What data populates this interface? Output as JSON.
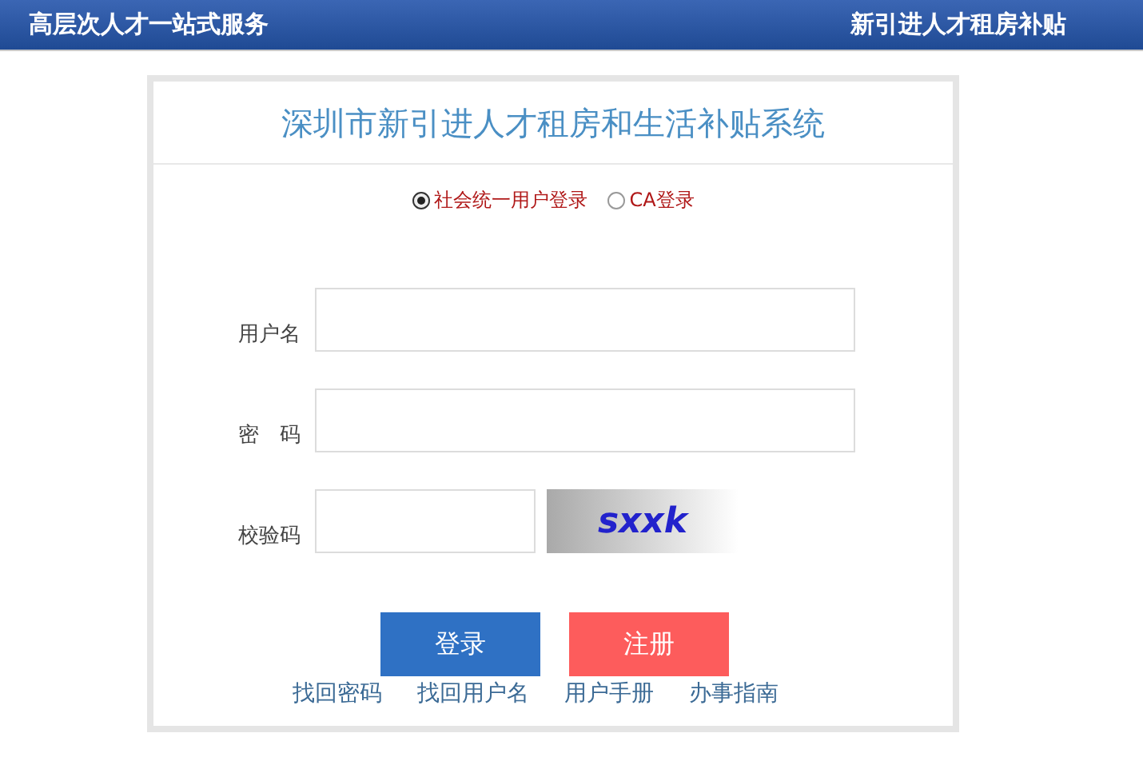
{
  "header": {
    "left": "高层次人才一站式服务",
    "right": "新引进人才租房补贴"
  },
  "card": {
    "title": "深圳市新引进人才租房和生活补贴系统"
  },
  "login_types": [
    {
      "label": "社会统一用户登录",
      "selected": true
    },
    {
      "label": "CA登录",
      "selected": false
    }
  ],
  "fields": [
    {
      "label": "用户名",
      "kind": "text"
    },
    {
      "label": "密　码",
      "kind": "password"
    },
    {
      "label": "校验码",
      "kind": "captcha",
      "captcha": "sxxk"
    }
  ],
  "buttons": [
    {
      "label": "登录",
      "kind": "primary"
    },
    {
      "label": "注册",
      "kind": "danger"
    }
  ],
  "links": [
    "找回密码",
    "找回用户名",
    "用户手册",
    "办事指南"
  ]
}
